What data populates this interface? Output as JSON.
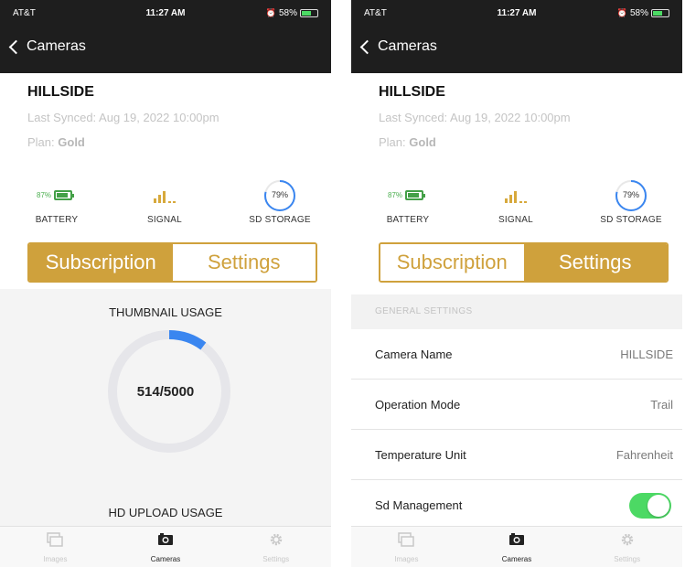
{
  "status": {
    "carrier": "AT&T",
    "time": "11:27 AM",
    "battery": "58%"
  },
  "nav": {
    "back_label": "Cameras"
  },
  "camera": {
    "name": "HILLSIDE",
    "last_synced": "Last Synced:  Aug 19, 2022 10:00pm",
    "plan_label": "Plan:",
    "plan_value": "Gold"
  },
  "stats": {
    "battery_pct": "87%",
    "battery_label": "BATTERY",
    "signal_label": "SIGNAL",
    "sd_pct": "79%",
    "sd_label": "SD STORAGE"
  },
  "tabs_segment": {
    "subscription": "Subscription",
    "settings": "Settings"
  },
  "subscription": {
    "thumbnail_title": "THUMBNAIL USAGE",
    "thumbnail_value": "514/5000",
    "thumbnail_used": 514,
    "thumbnail_total": 5000,
    "hd_title": "HD UPLOAD USAGE"
  },
  "settings": {
    "section_header": "GENERAL SETTINGS",
    "rows": [
      {
        "label": "Camera Name",
        "value": "HILLSIDE"
      },
      {
        "label": "Operation Mode",
        "value": "Trail"
      },
      {
        "label": "Temperature Unit",
        "value": "Fahrenheit"
      },
      {
        "label": "Sd Management",
        "toggle_on": true
      }
    ]
  },
  "tabbar": {
    "images": "Images",
    "cameras": "Cameras",
    "settings": "Settings"
  },
  "colors": {
    "accent": "#cfa13c",
    "battery_green": "#43a047",
    "toggle_green": "#4cd964",
    "progress_blue": "#3a86f0"
  },
  "icons": {
    "back": "chevron-left-icon",
    "wifi": "wifi-icon",
    "alarm": "alarm-icon",
    "images_tab": "images-icon",
    "cameras_tab": "camera-icon",
    "settings_tab": "gear-icon"
  }
}
